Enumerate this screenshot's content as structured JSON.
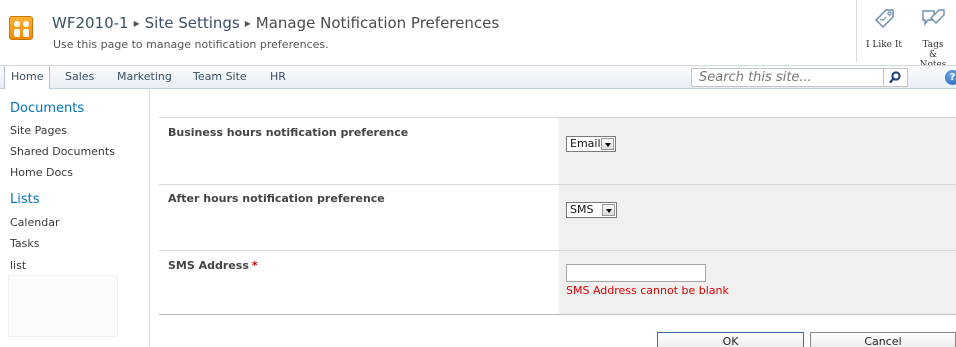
{
  "title_area": {
    "breadcrumb": {
      "site": "WF2010-1",
      "section": "Site Settings",
      "page": "Manage Notification Preferences",
      "separator": "▸"
    },
    "description": "Use this page to manage notification preferences.",
    "actions": [
      {
        "label": "I Like It",
        "icon": "like-tag-icon"
      },
      {
        "label": "Tags & Notes",
        "icon": "tags-notes-icon"
      }
    ]
  },
  "top_nav": {
    "items": [
      {
        "label": "Home",
        "selected": true
      },
      {
        "label": "Sales",
        "selected": false
      },
      {
        "label": "Marketing",
        "selected": false
      },
      {
        "label": "Team Site",
        "selected": false
      },
      {
        "label": "HR",
        "selected": false
      }
    ],
    "search_placeholder": "Search this site...",
    "help_glyph": "?"
  },
  "left_nav": {
    "documents_heading": "Documents",
    "documents": [
      "Site Pages",
      "Shared Documents",
      "Home Docs"
    ],
    "lists_heading": "Lists",
    "lists": [
      "Calendar",
      "Tasks",
      "list"
    ]
  },
  "form": {
    "business_hours": {
      "label": "Business hours notification preference",
      "value": "Email"
    },
    "after_hours": {
      "label": "After hours notification preference",
      "value": "SMS"
    },
    "sms_address": {
      "label": "SMS Address",
      "required_marker": "*",
      "value": "",
      "error": "SMS Address cannot be blank"
    },
    "ok_label": "OK",
    "cancel_label": "Cancel"
  },
  "colors": {
    "link_blue": "#0072bc",
    "error_red": "#e00000",
    "field_bg": "#f0f0f0"
  }
}
